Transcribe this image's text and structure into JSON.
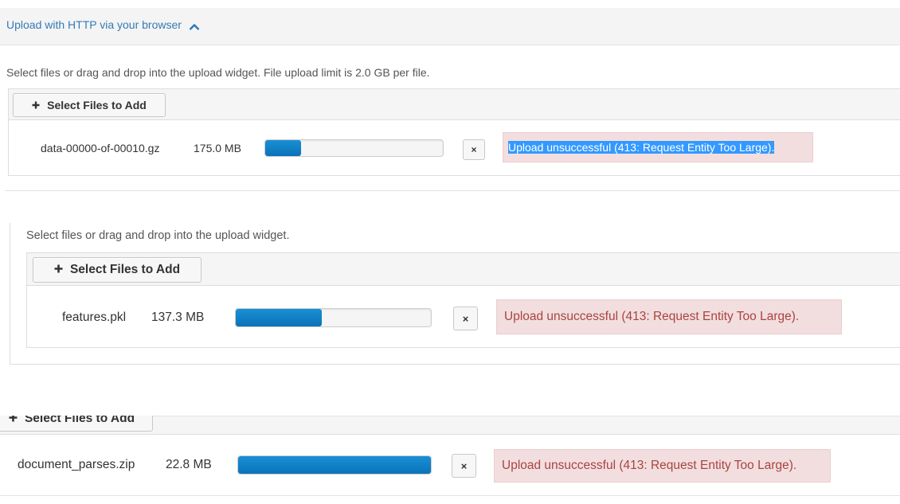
{
  "header": {
    "title": "Upload with HTTP via your browser"
  },
  "section1": {
    "help_text": "Select files or drag and drop into the upload widget. File upload limit is 2.0 GB per file.",
    "select_label": "Select Files to Add",
    "file": {
      "name": "data-00000-of-00010.gz",
      "size": "175.0 MB",
      "progress": 0.2,
      "remove_label": "×",
      "error": "Upload unsuccessful (413: Request Entity Too Large)."
    }
  },
  "section2": {
    "help_text": "Select files or drag and drop into the upload widget.",
    "select_label": "Select Files to Add",
    "file": {
      "name": "features.pkl",
      "size": "137.3 MB",
      "progress": 0.44,
      "remove_label": "×",
      "error": "Upload unsuccessful (413: Request Entity Too Large)."
    }
  },
  "section3": {
    "select_label": "Select Files to Add",
    "file": {
      "name": "document_parses.zip",
      "size": "22.8 MB",
      "progress": 1.0,
      "remove_label": "×",
      "error": "Upload unsuccessful (413: Request Entity Too Large)."
    }
  },
  "colors": {
    "link": "#337ab7",
    "progress": "#0a73b8",
    "error_bg": "#f2dede",
    "error_text": "#a94442",
    "selection": "#3399ff"
  }
}
